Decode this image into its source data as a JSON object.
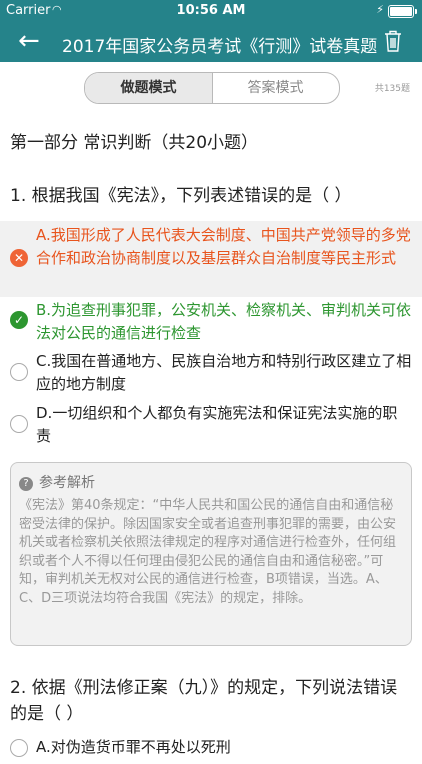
{
  "status": {
    "carrier": "Carrier",
    "time": "10:56 AM"
  },
  "nav": {
    "title": "2017年国家公务员考试《行测》试卷真题"
  },
  "mode": {
    "practice": "做题模式",
    "answer": "答案模式",
    "count": "共135题"
  },
  "section": "第一部分 常识判断（共20小题）",
  "q1": {
    "title": "1. 根据我国《宪法》，下列表述错误的是（ ）",
    "options": [
      {
        "text": "A.我国形成了人民代表大会制度、中国共产党领导的多党合作和政治协商制度以及基层群众自治制度等民主形式",
        "state": "wrong"
      },
      {
        "text": "B.为追查刑事犯罪，公安机关、检察机关、审判机关可依法对公民的通信进行检查",
        "state": "correct"
      },
      {
        "text": "C.我国在普通地方、民族自治地方和特别行政区建立了相应的地方制度",
        "state": "none"
      },
      {
        "text": "D.一切组织和个人都负有实施宪法和保证宪法实施的职责",
        "state": "none"
      }
    ],
    "analysis_title": "参考解析",
    "analysis": "《宪法》第40条规定：“中华人民共和国公民的通信自由和通信秘密受法律的保护。除因国家安全或者追查刑事犯罪的需要，由公安机关或者检察机关依照法律规定的程序对通信进行检查外，任何组织或者个人不得以任何理由侵犯公民的通信自由和通信秘密。”可知，审判机关无权对公民的通信进行检查，B项错误，当选。A、C、D三项说法均符合我国《宪法》的规定，排除。"
  },
  "q2": {
    "title": "2. 依据《刑法修正案（九）》的规定，下列说法错误的是（ ）",
    "option_a": "A.对伪造货币罪不再处以死刑"
  },
  "colors": {
    "accent": "#25838a",
    "wrong": "#e8541d",
    "correct": "#2d9630"
  }
}
